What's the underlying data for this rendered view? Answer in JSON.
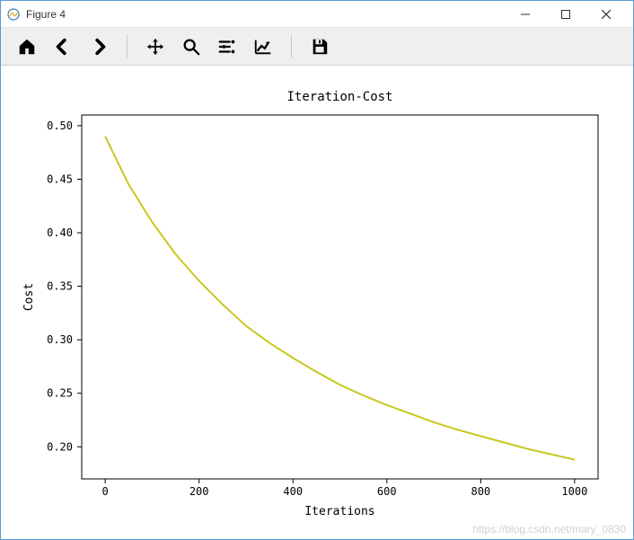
{
  "window": {
    "title": "Figure 4"
  },
  "toolbar": {
    "home": "Home",
    "back": "Back",
    "forward": "Forward",
    "pan": "Pan",
    "zoom": "Zoom",
    "subplots": "Configure subplots",
    "axes": "Edit axis",
    "save": "Save"
  },
  "watermark": "https://blog.csdn.net/mary_0830",
  "chart_data": {
    "type": "line",
    "title": "Iteration-Cost",
    "xlabel": "Iterations",
    "ylabel": "Cost",
    "xlim": [
      -50,
      1050
    ],
    "ylim": [
      0.17,
      0.51
    ],
    "xticks": [
      0,
      200,
      400,
      600,
      800,
      1000
    ],
    "yticks": [
      0.2,
      0.25,
      0.3,
      0.35,
      0.4,
      0.45,
      0.5
    ],
    "series": [
      {
        "name": "cost",
        "color": "#c8c820",
        "x": [
          0,
          50,
          100,
          150,
          200,
          250,
          300,
          350,
          400,
          450,
          500,
          550,
          600,
          650,
          700,
          750,
          800,
          850,
          900,
          950,
          1000
        ],
        "y": [
          0.49,
          0.445,
          0.41,
          0.38,
          0.355,
          0.333,
          0.313,
          0.297,
          0.283,
          0.27,
          0.258,
          0.248,
          0.239,
          0.231,
          0.223,
          0.216,
          0.21,
          0.204,
          0.198,
          0.193,
          0.188
        ]
      }
    ]
  }
}
